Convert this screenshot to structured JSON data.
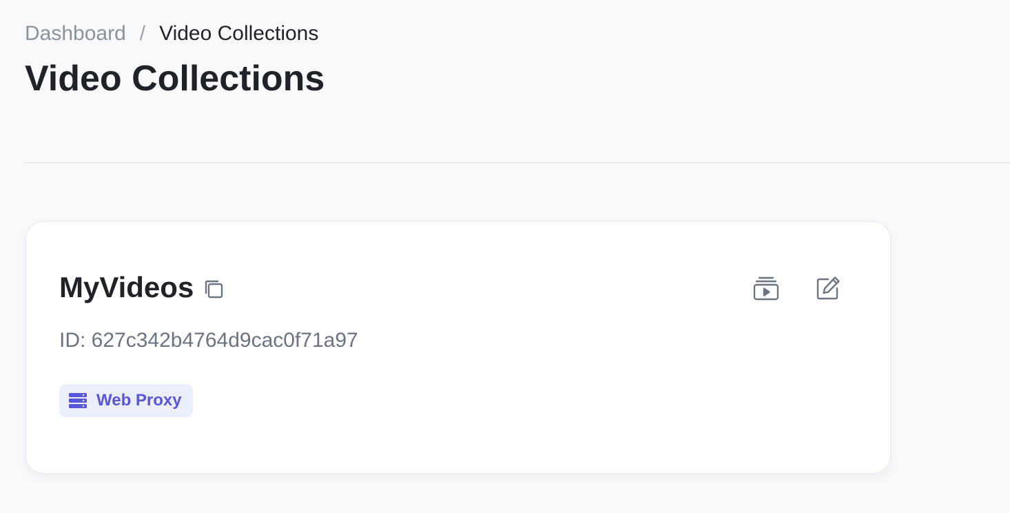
{
  "breadcrumb": {
    "items": [
      {
        "label": "Dashboard"
      },
      {
        "label": "Video Collections"
      }
    ],
    "separator": "/"
  },
  "page": {
    "title": "Video Collections"
  },
  "collections": [
    {
      "name": "MyVideos",
      "id_text": "ID: 627c342b4764d9cac0f71a97",
      "tag": {
        "label": "Web Proxy",
        "icon": "server-icon",
        "color": "#5b55d8",
        "background": "#ebeffc"
      },
      "actions": [
        {
          "icon": "video-library-icon"
        },
        {
          "icon": "edit-icon"
        }
      ],
      "copy_icon": "copy-icon"
    }
  ],
  "colors": {
    "background": "#f8f9fb",
    "card": "#ffffff",
    "text_primary": "#1f2328",
    "text_muted": "#6b7280",
    "icon": "#6b7480"
  }
}
